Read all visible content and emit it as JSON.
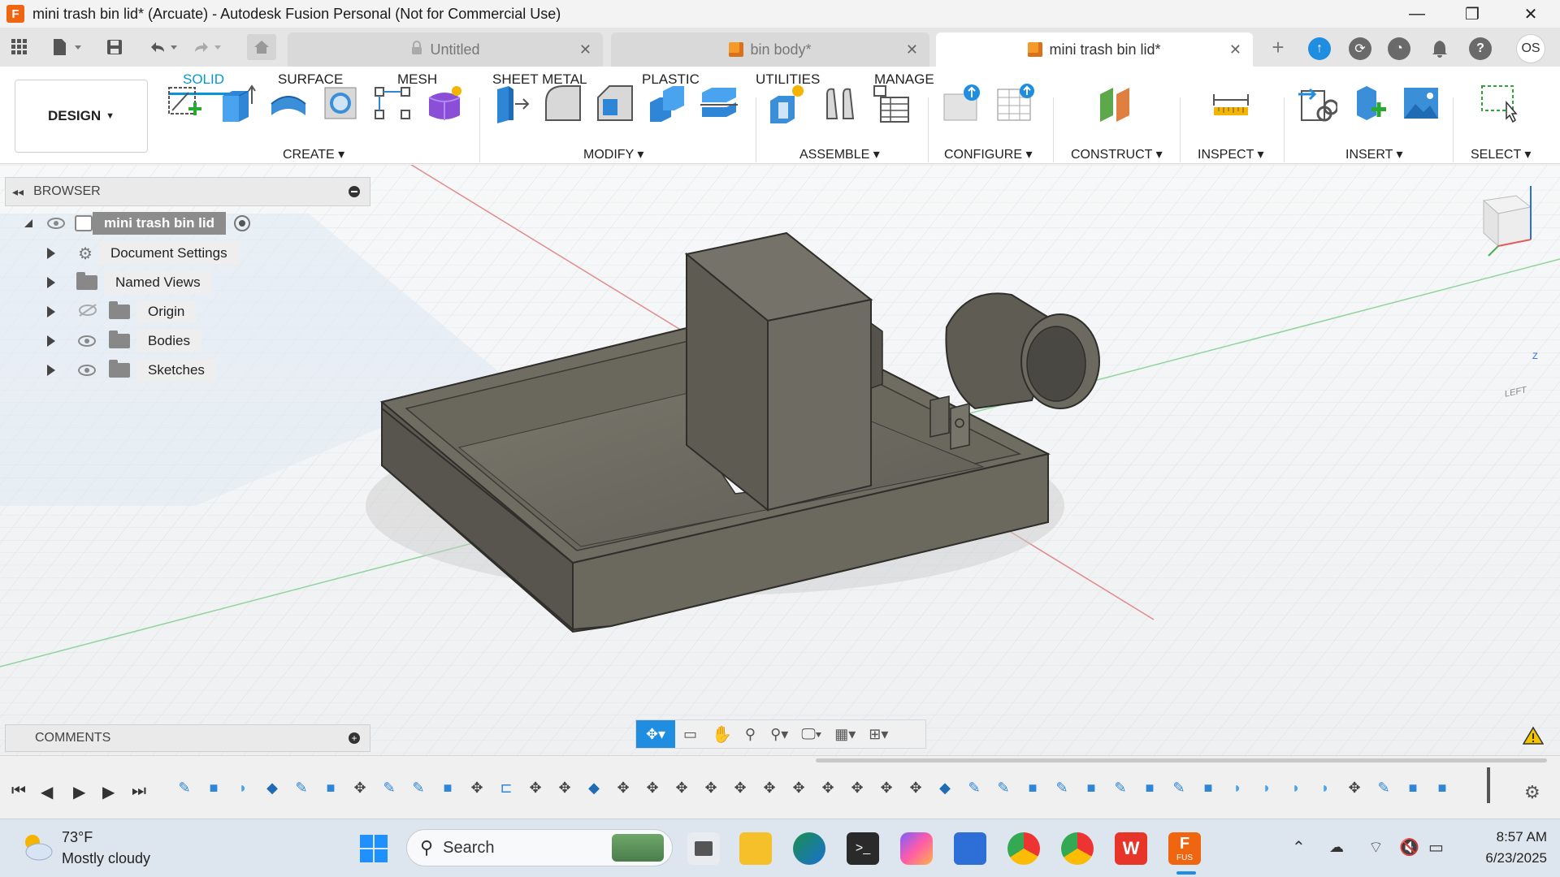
{
  "window": {
    "title": "mini trash bin lid* (Arcuate) - Autodesk Fusion Personal (Not for Commercial Use)",
    "app_icon_letter": "F",
    "minimize_glyph": "—",
    "maximize_glyph": "❐",
    "close_glyph": "✕"
  },
  "tabs": [
    {
      "label": "Untitled",
      "icon": "lock-icon",
      "active": false
    },
    {
      "label": "bin body*",
      "icon": "cube-icon",
      "active": false
    },
    {
      "label": "mini trash bin lid*",
      "icon": "cube-icon",
      "active": true
    }
  ],
  "tab_close_glyph": "✕",
  "new_tab_glyph": "+",
  "user_initials": "OS",
  "ribbon": {
    "workspace": "DESIGN",
    "tabs": [
      "SOLID",
      "SURFACE",
      "MESH",
      "SHEET METAL",
      "PLASTIC",
      "UTILITIES",
      "MANAGE"
    ],
    "active_tab": "SOLID",
    "groups": [
      "CREATE",
      "MODIFY",
      "ASSEMBLE",
      "CONFIGURE",
      "CONSTRUCT",
      "INSPECT",
      "INSERT",
      "SELECT"
    ]
  },
  "browser": {
    "title": "BROWSER",
    "root": "mini trash bin lid",
    "items": [
      {
        "label": "Document Settings",
        "icon": "gear-icon",
        "eye": false
      },
      {
        "label": "Named Views",
        "icon": "folder-icon",
        "eye": false
      },
      {
        "label": "Origin",
        "icon": "folder-icon",
        "eye": "hidden"
      },
      {
        "label": "Bodies",
        "icon": "folder-icon",
        "eye": "visible"
      },
      {
        "label": "Sketches",
        "icon": "folder-icon",
        "eye": "visible"
      }
    ]
  },
  "comments": {
    "title": "COMMENTS"
  },
  "viewcube": {
    "face": "LEFT",
    "z": "Z"
  },
  "taskbar": {
    "weather_temp": "73°F",
    "weather_desc": "Mostly cloudy",
    "search_placeholder": "Search",
    "time": "8:57 AM",
    "date": "6/23/2025",
    "fusion_label": "FUS"
  },
  "colors": {
    "accent": "#0696d7",
    "body": "#6e6c62",
    "fusion_orange": "#f0650f"
  }
}
